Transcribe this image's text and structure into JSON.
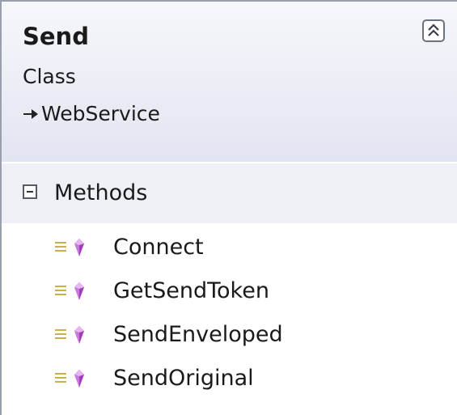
{
  "shape": {
    "name": "Send",
    "stereotype": "Class",
    "base_class": "WebService",
    "header_color": "#e2e5f1",
    "icons": {
      "collapse": "double-chevron-up-icon",
      "inheritance": "inheritance-arrow-icon",
      "section_toggle": "minus-box-icon",
      "method": "method-icon"
    }
  },
  "sections": [
    {
      "label": "Methods",
      "members": [
        {
          "label": "Connect"
        },
        {
          "label": "GetSendToken"
        },
        {
          "label": "SendEnveloped"
        },
        {
          "label": "SendOriginal"
        }
      ]
    }
  ]
}
